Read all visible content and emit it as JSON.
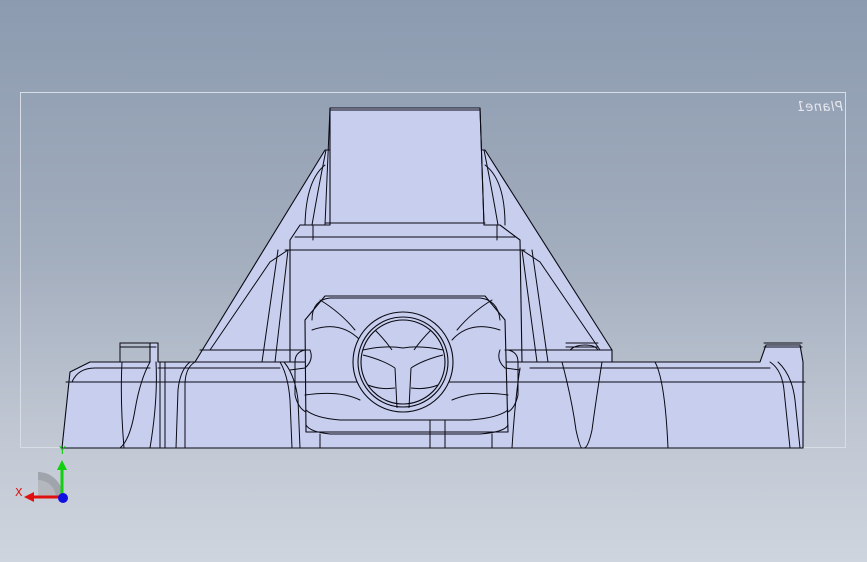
{
  "viewport": {
    "plane_label": "Plane1",
    "colors": {
      "background_top": "#8c9bb0",
      "background_bottom": "#cfd5de",
      "model_fill": "#c8cfee",
      "model_edge": "#0a0a14",
      "plane_border": "#d9dde6"
    }
  },
  "triad": {
    "x_label": "X",
    "y_label": "Y",
    "x_color": "#e01010",
    "y_color": "#10d010",
    "z_color": "#1010e0"
  }
}
